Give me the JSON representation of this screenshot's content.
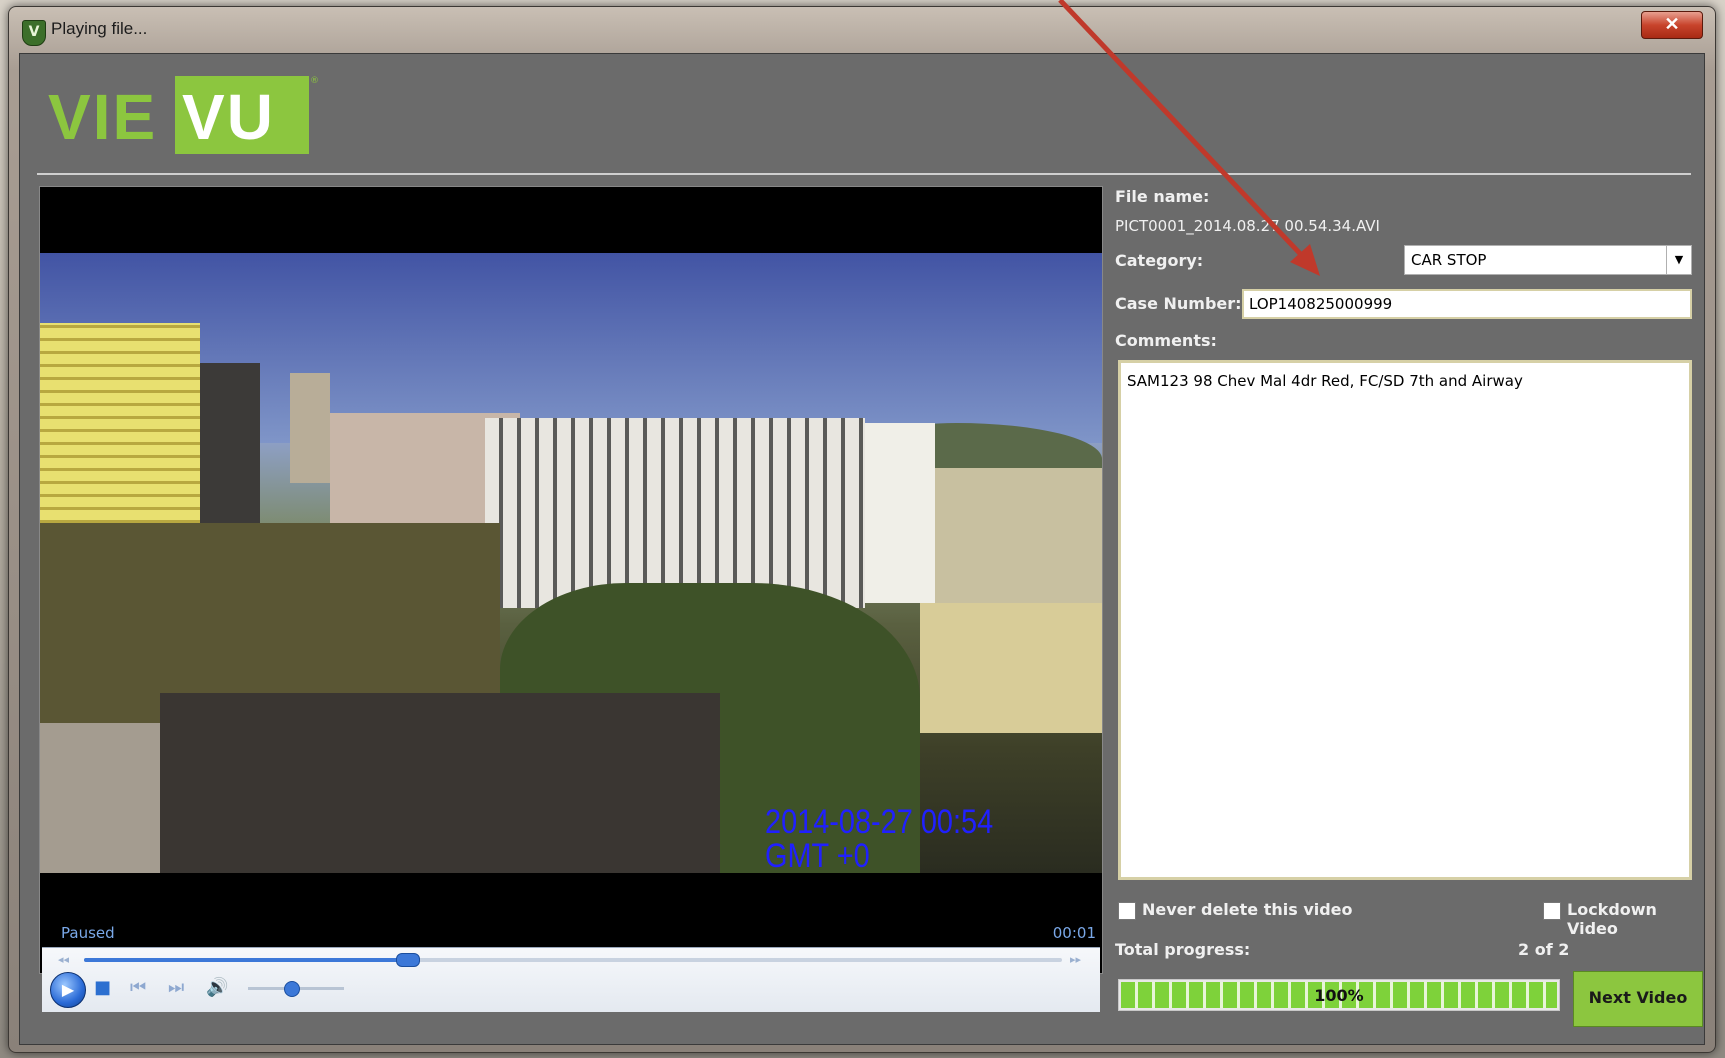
{
  "window": {
    "title": "Playing file...",
    "close_label": "✕"
  },
  "logo": {
    "part1": "VIE",
    "part2": "VU"
  },
  "player": {
    "status": "Paused",
    "elapsed": "00:01",
    "progress_fraction": 0.33,
    "volume_fraction": 0.45,
    "overlay_timestamp_line1": "2014-08-27  00:54",
    "overlay_timestamp_line2": "GMT  +0"
  },
  "details": {
    "file_name_label": "File name:",
    "file_name_value": "PICT0001_2014.08.27 00.54.34.AVI",
    "category_label": "Category:",
    "category_value": "CAR STOP",
    "case_number_label": "Case Number:",
    "case_number_value": "LOP140825000999",
    "comments_label": "Comments:",
    "comments_value": "SAM123 98 Chev Mal 4dr Red, FC/SD 7th and Airway",
    "never_delete_label": "Never delete this video",
    "lockdown_label": "Lockdown Video",
    "total_progress_label": "Total progress:",
    "count_text": "2 of 2",
    "progress_text": "100%",
    "progress_fraction": 1.0,
    "next_button_label": "Next Video"
  },
  "colors": {
    "brand_green": "#8cc63f",
    "panel_gray": "#6b6b6b",
    "annotation_red": "#c0392b"
  }
}
